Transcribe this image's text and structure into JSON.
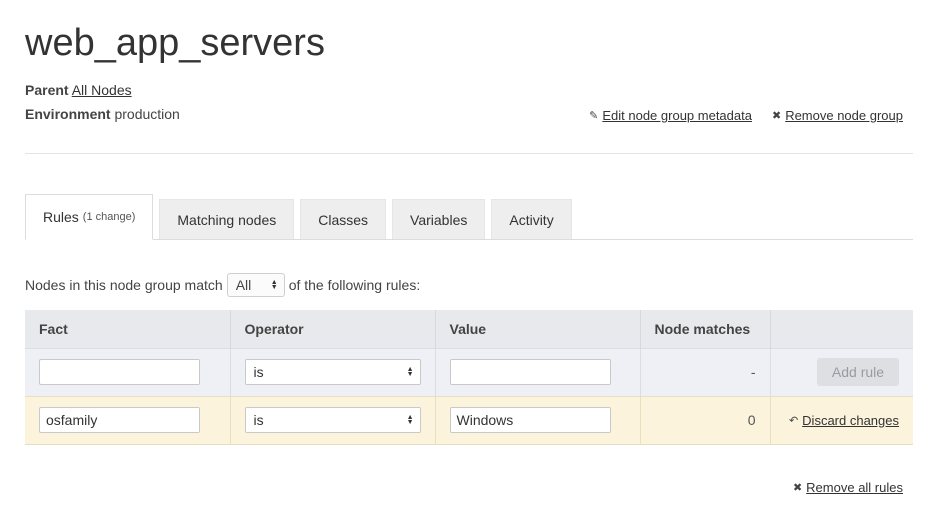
{
  "page": {
    "title": "web_app_servers",
    "parent_label": "Parent",
    "parent_link": "All Nodes",
    "environment_label": "Environment",
    "environment_value": "production"
  },
  "actions": {
    "edit_metadata": "Edit node group metadata",
    "remove_group": "Remove node group",
    "edit_icon": "pencil-icon",
    "remove_icon": "x-icon"
  },
  "tabs": [
    {
      "label": "Rules",
      "note": "(1 change)",
      "active": true
    },
    {
      "label": "Matching nodes"
    },
    {
      "label": "Classes"
    },
    {
      "label": "Variables"
    },
    {
      "label": "Activity"
    }
  ],
  "rules": {
    "match_prefix": "Nodes in this node group match",
    "match_value": "All",
    "match_suffix": "of the following rules:",
    "headers": {
      "fact": "Fact",
      "operator": "Operator",
      "value": "Value",
      "node_matches": "Node matches"
    },
    "new_rule": {
      "fact": "",
      "operator": "is",
      "value": "",
      "node_matches": "-",
      "add_button": "Add rule"
    },
    "rows": [
      {
        "fact": "osfamily",
        "operator": "is",
        "value": "Windows",
        "node_matches": "0",
        "discard": "Discard changes"
      }
    ],
    "remove_all": "Remove all rules"
  },
  "colors": {
    "changed_row_bg": "#fbf3dc",
    "header_bg": "#e8e9ec",
    "new_row_bg": "#eef0f6"
  }
}
